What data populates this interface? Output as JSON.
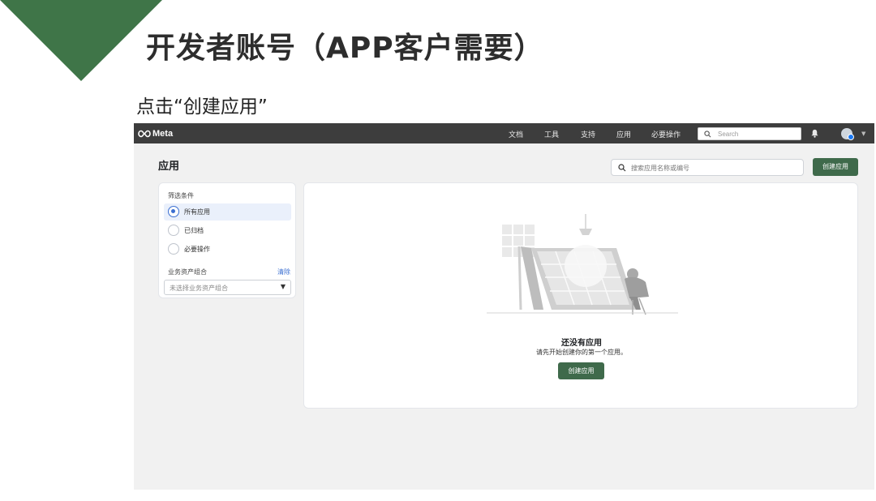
{
  "slide": {
    "title": "开发者账号（APP客户需要）",
    "instruction": "点击“创建应用”",
    "accent_color": "#3f7548"
  },
  "topbar": {
    "brand": "Meta",
    "nav": [
      "文档",
      "工具",
      "支持",
      "应用",
      "必要操作"
    ],
    "search_placeholder": "Search"
  },
  "page": {
    "title": "应用",
    "search_placeholder": "搜索应用名称或编号",
    "create_button": "创建应用"
  },
  "filter": {
    "heading": "筛选条件",
    "options": [
      "所有应用",
      "已归档",
      "必要操作"
    ],
    "selected": "所有应用",
    "portfolio_label": "业务资产组合",
    "clear_label": "清除",
    "portfolio_placeholder": "未选择业务资产组合"
  },
  "empty_state": {
    "title": "还没有应用",
    "description": "请先开始创建你的第一个应用。",
    "button": "创建应用"
  },
  "colors": {
    "primary_button": "#3f6a4b",
    "topbar": "#3d3d3d",
    "radio_active": "#3b6fd1"
  }
}
